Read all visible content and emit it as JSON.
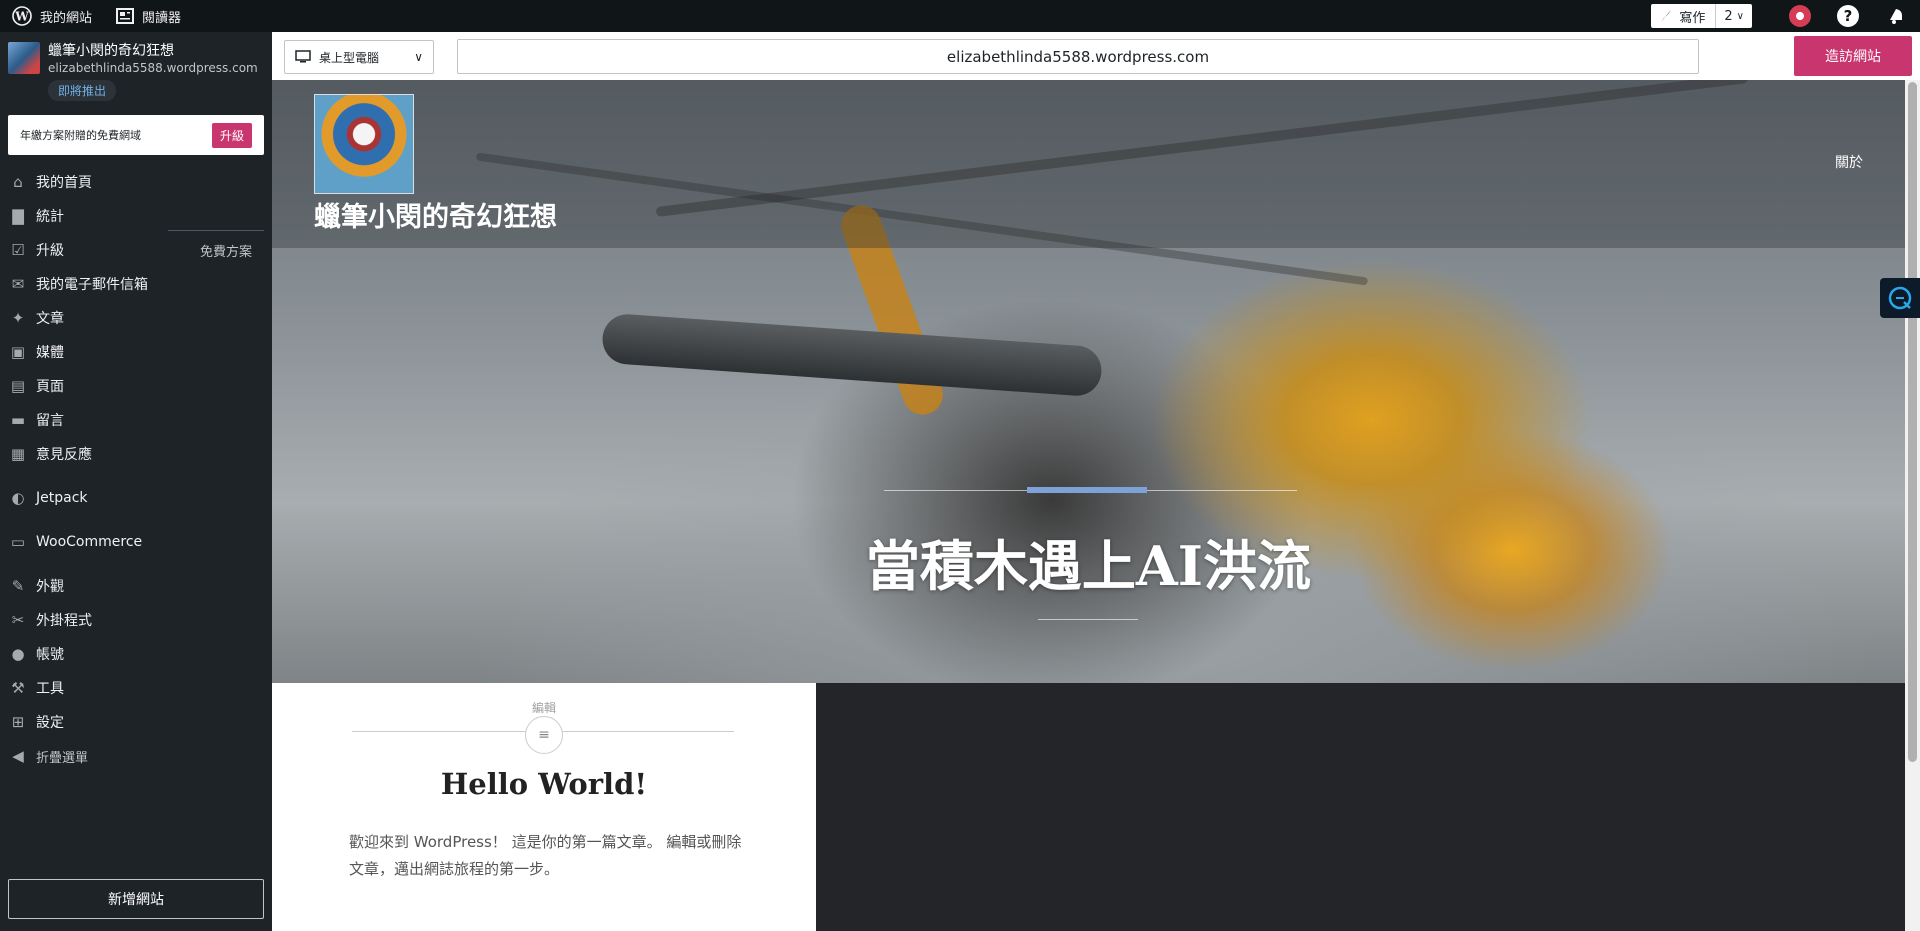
{
  "topbar": {
    "my_sites": "我的網站",
    "reader": "閱讀器",
    "write": "寫作",
    "write_count": "2"
  },
  "sidebar": {
    "site_name": "蠟筆小閔的奇幻狂想",
    "site_url": "elizabethlinda5588.wordpress.com",
    "launch_badge": "即將推出",
    "upsell_text": "年繳方案附贈的免費網域",
    "upsell_button": "升級",
    "items": [
      {
        "label": "我的首頁",
        "icon": "home-icon"
      },
      {
        "label": "統計",
        "icon": "stats-icon"
      },
      {
        "label": "升級",
        "icon": "cart-icon",
        "right": "免費方案"
      },
      {
        "label": "我的電子郵件信箱",
        "icon": "mail-icon"
      },
      {
        "label": "文章",
        "icon": "pin-icon"
      },
      {
        "label": "媒體",
        "icon": "media-icon"
      },
      {
        "label": "頁面",
        "icon": "page-icon"
      },
      {
        "label": "留言",
        "icon": "comment-icon"
      },
      {
        "label": "意見反應",
        "icon": "feedback-icon"
      },
      {
        "label": "Jetpack",
        "icon": "jetpack-icon"
      },
      {
        "label": "WooCommerce",
        "icon": "woo-icon"
      },
      {
        "label": "外觀",
        "icon": "brush-icon"
      },
      {
        "label": "外掛程式",
        "icon": "plugin-icon"
      },
      {
        "label": "帳號",
        "icon": "user-icon"
      },
      {
        "label": "工具",
        "icon": "wrench-icon"
      },
      {
        "label": "設定",
        "icon": "settings-icon"
      },
      {
        "label": "折疊選單",
        "icon": "collapse-icon"
      }
    ],
    "new_site": "新增網站"
  },
  "preview_bar": {
    "device": "桌上型電腦",
    "url": "elizabethlinda5588.wordpress.com",
    "visit": "造訪網站"
  },
  "preview": {
    "site_title": "蠟筆小閔的奇幻狂想",
    "nav_about": "關於",
    "hero_title": "當積木遇上AI洪流",
    "post_category": "編輯",
    "post_title": "Hello World!",
    "post_excerpt": "歡迎來到 WordPress！ 這是你的第一篇文章。 編輯或刪除文章，邁出網誌旅程的第一步。"
  },
  "colors": {
    "accent": "#c9356e",
    "admin_bg": "#1d2327",
    "topbar_bg": "#101517",
    "link_blue": "#72aee6"
  }
}
